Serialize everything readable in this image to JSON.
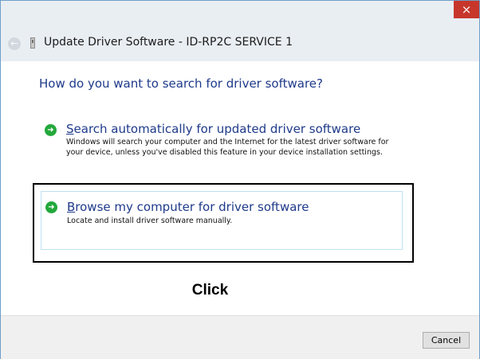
{
  "window": {
    "title": "Update Driver Software - ID-RP2C SERVICE 1",
    "close_glyph": "×",
    "back_glyph": "←"
  },
  "dialog": {
    "question": "How do you want to search for driver software?",
    "options": [
      {
        "accel": "S",
        "title_rest": "earch automatically for updated driver software",
        "description": "Windows will search your computer and the Internet for the latest driver software for your device, unless you've disabled this feature in your device installation settings.",
        "icon": "green-arrow-icon"
      },
      {
        "accel": "B",
        "title_rest": "rowse my computer for driver software",
        "description": "Locate and install driver software manually.",
        "icon": "green-arrow-icon"
      }
    ]
  },
  "annotation": {
    "label": "Click"
  },
  "footer": {
    "cancel_label": "Cancel"
  },
  "colors": {
    "accent": "#1e3a8a",
    "close": "#c7362b",
    "arrow": "#23a83c"
  }
}
